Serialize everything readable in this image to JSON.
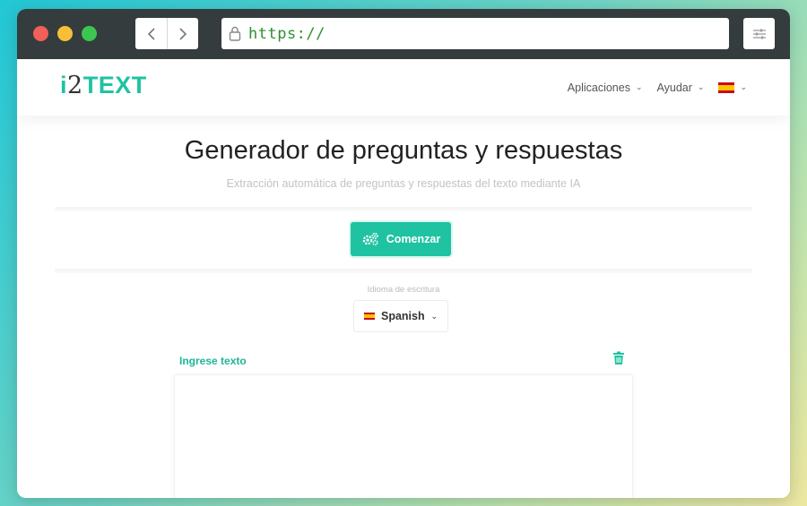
{
  "browser": {
    "url": "https://",
    "icons": [
      "chevron-left-icon",
      "chevron-right-icon",
      "lock-icon",
      "sliders-icon"
    ]
  },
  "header": {
    "logo_prefix": "i",
    "logo_number": "2",
    "logo_suffix": "TEXT",
    "menu": {
      "apps_label": "Aplicaciones",
      "help_label": "Ayudar"
    }
  },
  "main": {
    "title": "Generador de preguntas y respuestas",
    "subtitle": "Extracción automática de preguntas y respuestas del texto mediante IA",
    "start_label": "Comenzar",
    "language_label": "Idioma de escritura",
    "language_value": "Spanish",
    "input_label": "Ingrese texto"
  },
  "colors": {
    "accent": "#1fc3a2",
    "browser_chrome": "#353c3e",
    "url_text": "#2f8f2f"
  }
}
